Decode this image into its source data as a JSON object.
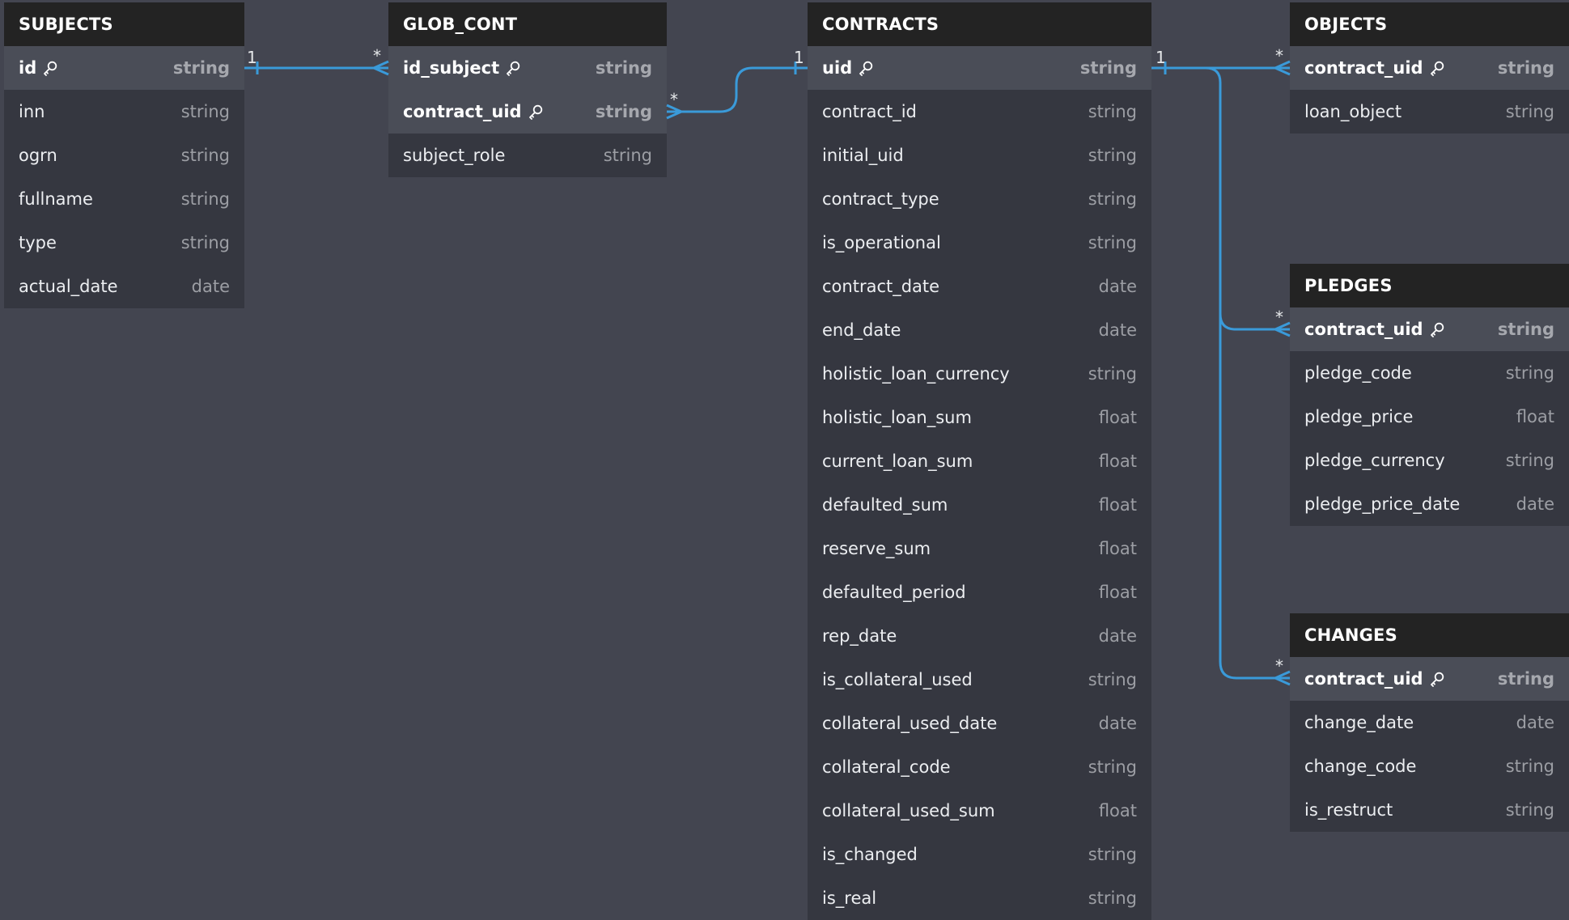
{
  "tables": {
    "subjects": {
      "title": "SUBJECTS",
      "columns": [
        {
          "name": "id",
          "type": "string",
          "key": true
        },
        {
          "name": "inn",
          "type": "string"
        },
        {
          "name": "ogrn",
          "type": "string"
        },
        {
          "name": "fullname",
          "type": "string"
        },
        {
          "name": "type",
          "type": "string"
        },
        {
          "name": "actual_date",
          "type": "date"
        }
      ]
    },
    "glob_cont": {
      "title": "GLOB_CONT",
      "columns": [
        {
          "name": "id_subject",
          "type": "string",
          "key": true
        },
        {
          "name": "contract_uid",
          "type": "string",
          "key": true
        },
        {
          "name": "subject_role",
          "type": "string"
        }
      ]
    },
    "contracts": {
      "title": "CONTRACTS",
      "columns": [
        {
          "name": "uid",
          "type": "string",
          "key": true
        },
        {
          "name": "contract_id",
          "type": "string"
        },
        {
          "name": "initial_uid",
          "type": "string"
        },
        {
          "name": "contract_type",
          "type": "string"
        },
        {
          "name": "is_operational",
          "type": "string"
        },
        {
          "name": "contract_date",
          "type": "date"
        },
        {
          "name": "end_date",
          "type": "date"
        },
        {
          "name": "holistic_loan_currency",
          "type": "string"
        },
        {
          "name": "holistic_loan_sum",
          "type": "float"
        },
        {
          "name": "current_loan_sum",
          "type": "float"
        },
        {
          "name": "defaulted_sum",
          "type": "float"
        },
        {
          "name": "reserve_sum",
          "type": "float"
        },
        {
          "name": "defaulted_period",
          "type": "float"
        },
        {
          "name": "rep_date",
          "type": "date"
        },
        {
          "name": "is_collateral_used",
          "type": "string"
        },
        {
          "name": "collateral_used_date",
          "type": "date"
        },
        {
          "name": "collateral_code",
          "type": "string"
        },
        {
          "name": "collateral_used_sum",
          "type": "float"
        },
        {
          "name": "is_changed",
          "type": "string"
        },
        {
          "name": "is_real",
          "type": "string"
        }
      ]
    },
    "objects": {
      "title": "OBJECTS",
      "columns": [
        {
          "name": "contract_uid",
          "type": "string",
          "key": true
        },
        {
          "name": "loan_object",
          "type": "string"
        }
      ]
    },
    "pledges": {
      "title": "PLEDGES",
      "columns": [
        {
          "name": "contract_uid",
          "type": "string",
          "key": true
        },
        {
          "name": "pledge_code",
          "type": "string"
        },
        {
          "name": "pledge_price",
          "type": "float"
        },
        {
          "name": "pledge_currency",
          "type": "string"
        },
        {
          "name": "pledge_price_date",
          "type": "date"
        }
      ]
    },
    "changes": {
      "title": "CHANGES",
      "columns": [
        {
          "name": "contract_uid",
          "type": "string",
          "key": true
        },
        {
          "name": "change_date",
          "type": "date"
        },
        {
          "name": "change_code",
          "type": "string"
        },
        {
          "name": "is_restruct",
          "type": "string"
        }
      ]
    }
  },
  "relations": [
    {
      "from": "subjects.id",
      "to": "glob_cont.id_subject",
      "from_card": "1",
      "to_card": "*"
    },
    {
      "from": "contracts.uid",
      "to": "glob_cont.contract_uid",
      "from_card": "1",
      "to_card": "*"
    },
    {
      "from": "contracts.uid",
      "to": "objects.contract_uid",
      "from_card": "1",
      "to_card": "*"
    },
    {
      "from": "contracts.uid",
      "to": "pledges.contract_uid",
      "from_card": "1",
      "to_card": "*"
    },
    {
      "from": "contracts.uid",
      "to": "changes.contract_uid",
      "from_card": "1",
      "to_card": "*"
    }
  ],
  "colors": {
    "canvas": "#434550",
    "table_body": "#353740",
    "table_header": "#232323",
    "key_row": "#4a4d57",
    "relation_line": "#3a9ad9"
  },
  "icons": {
    "key": "key-icon"
  }
}
